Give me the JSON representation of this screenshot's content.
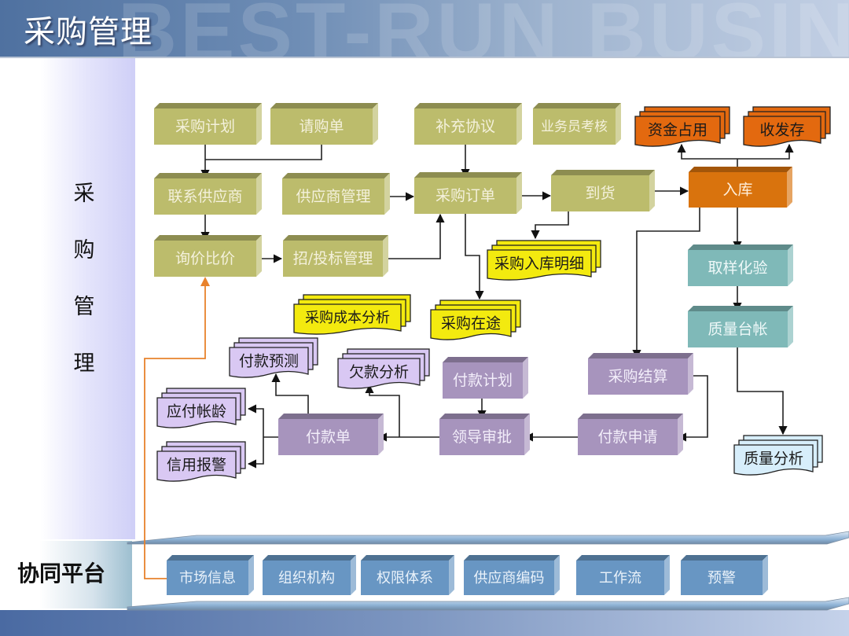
{
  "header": {
    "title": "采购管理",
    "watermark": "BEST-RUN BUSIN"
  },
  "sidebar": {
    "section_label_chars": [
      "采",
      "购",
      "管",
      "理"
    ],
    "platform_label": "协同平台"
  },
  "colors": {
    "olive": "#bcbc6c",
    "orange_process": "#d9730d",
    "orange_report": "#e3690f",
    "yellow_report": "#f3ea0f",
    "teal": "#7fb9b8",
    "purple_process": "#a794bd",
    "purple_report": "#d9c8f3",
    "lightblue_report": "#d7eefb",
    "platform_blue": "#6896c3",
    "orange_link": "#e8822c"
  },
  "diagram": {
    "process_boxes": {
      "purchase_plan": "采购计划",
      "requisition": "请购单",
      "supplementary_agreement": "补充协议",
      "salesman_assessment": "业务员考核",
      "contact_supplier": "联系供应商",
      "supplier_management": "供应商管理",
      "purchase_order": "采购订单",
      "arrival": "到货",
      "warehousing": "入库",
      "inquiry_comparison": "询价比价",
      "bidding_management": "招/投标管理",
      "sampling_test": "取样化验",
      "quality_ledger": "质量台帐",
      "purchase_settlement": "采购结算",
      "payment_plan": "付款计划",
      "payment_order": "付款单",
      "leader_approval": "领导审批",
      "payment_request": "付款申请"
    },
    "report_docs": {
      "fund_occupation": "资金占用",
      "receipt_issue_stock": "收发存",
      "purchase_inbound_detail": "采购入库明细",
      "purchase_cost_analysis": "采购成本分析",
      "purchase_in_transit": "采购在途",
      "payment_forecast": "付款预测",
      "arrears_analysis": "欠款分析",
      "payable_aging": "应付帐龄",
      "credit_alert": "信用报警",
      "quality_analysis": "质量分析"
    }
  },
  "platform": {
    "items": [
      "市场信息",
      "组织机构",
      "权限体系",
      "供应商编码",
      "工作流",
      "预警"
    ]
  }
}
